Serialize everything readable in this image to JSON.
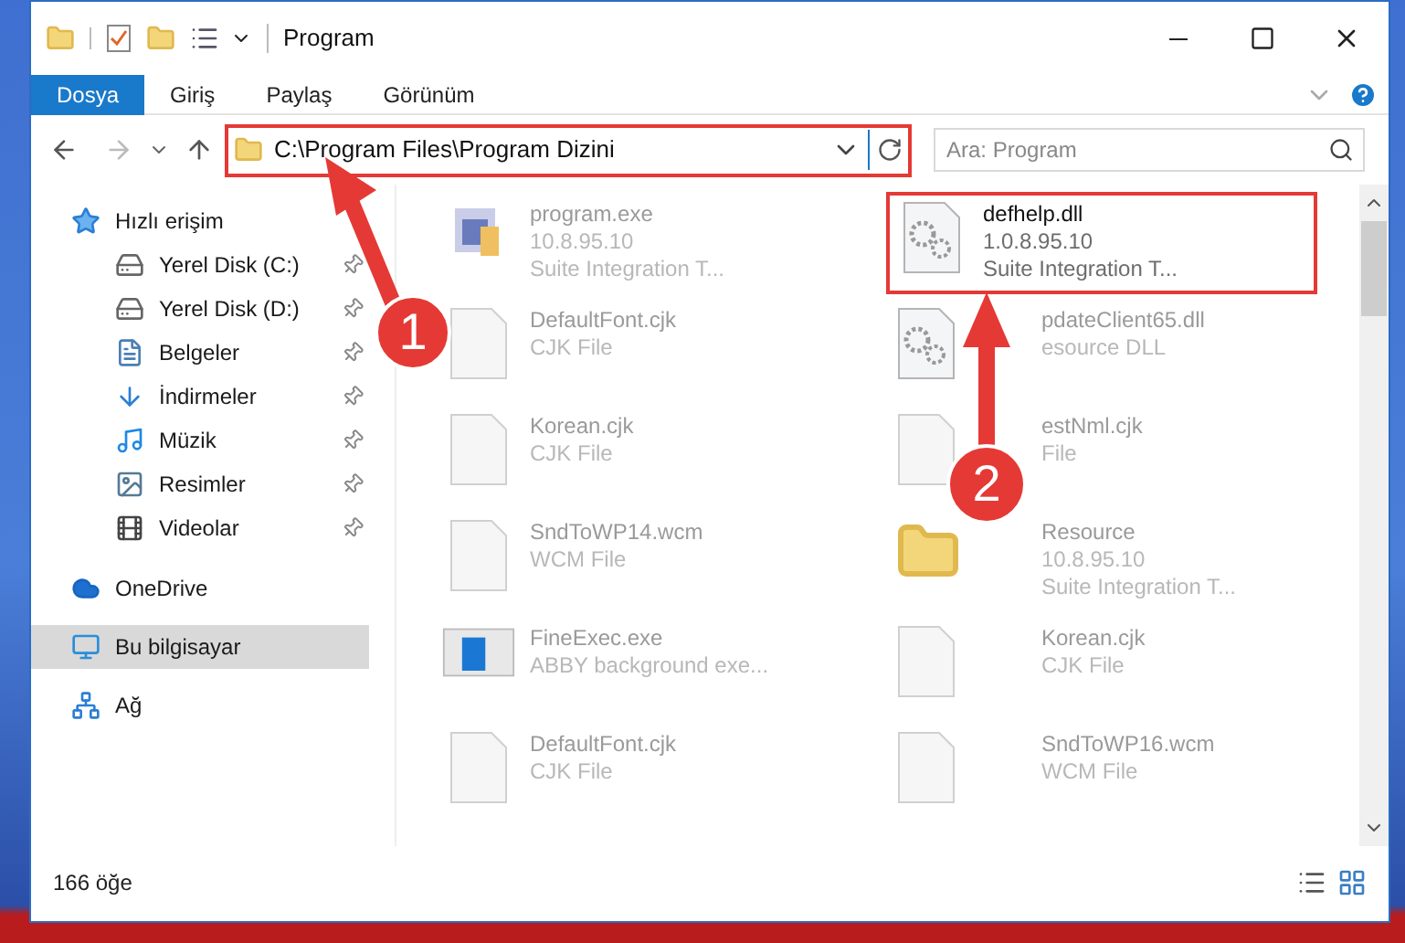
{
  "window": {
    "title": "Program"
  },
  "ribbon_tabs": [
    {
      "label": "Dosya",
      "selected": true
    },
    {
      "label": "Giriş",
      "selected": false
    },
    {
      "label": "Paylaş",
      "selected": false
    },
    {
      "label": "Görünüm",
      "selected": false
    }
  ],
  "address": {
    "path": "C:\\Program Files\\Program Dizini",
    "highlighted": true
  },
  "search": {
    "placeholder": "Ara: Program"
  },
  "sidebar": {
    "items": [
      {
        "label": "Hızlı erişim",
        "selected": false,
        "children": [
          {
            "label": "Yerel Disk (C:)",
            "pinned": true
          },
          {
            "label": "Yerel Disk (D:)",
            "pinned": true
          },
          {
            "label": "Belgeler",
            "pinned": true
          },
          {
            "label": "İndirmeler",
            "pinned": true
          },
          {
            "label": "Müzik",
            "pinned": true
          },
          {
            "label": "Resimler",
            "pinned": true
          },
          {
            "label": "Videolar",
            "pinned": true
          }
        ]
      },
      {
        "label": "OneDrive",
        "selected": false
      },
      {
        "label": "Bu bilgisayar",
        "selected": true
      },
      {
        "label": "Ağ",
        "selected": false
      }
    ]
  },
  "files": [
    {
      "name": "program.exe",
      "details": [
        "10.8.95.10",
        "Suite Integration T..."
      ],
      "kind": "exe",
      "highlighted": false
    },
    {
      "name": "defhelp.dll",
      "details": [
        "1.0.8.95.10",
        "Suite Integration T..."
      ],
      "kind": "dll",
      "highlighted": true
    },
    {
      "name": "DefaultFont.cjk",
      "details": [
        "CJK File"
      ],
      "kind": "blank",
      "highlighted": false
    },
    {
      "name": "pdateClient65.dll",
      "details": [
        "esource DLL"
      ],
      "kind": "dll",
      "highlighted": false
    },
    {
      "name": "Korean.cjk",
      "details": [
        "CJK File"
      ],
      "kind": "blank",
      "highlighted": false
    },
    {
      "name": "estNml.cjk",
      "details": [
        "File"
      ],
      "kind": "blank",
      "highlighted": false
    },
    {
      "name": "SndToWP14.wcm",
      "details": [
        "WCM File"
      ],
      "kind": "blank",
      "highlighted": false
    },
    {
      "name": "Resource",
      "details": [
        "10.8.95.10",
        "Suite Integration T..."
      ],
      "kind": "folder",
      "highlighted": false
    },
    {
      "name": "FineExec.exe",
      "details": [
        "ABBY background exe..."
      ],
      "kind": "app",
      "highlighted": false
    },
    {
      "name": "Korean.cjk",
      "details": [
        "CJK File"
      ],
      "kind": "blank",
      "highlighted": false
    },
    {
      "name": "DefaultFont.cjk",
      "details": [
        "CJK File"
      ],
      "kind": "blank",
      "highlighted": false
    },
    {
      "name": "SndToWP16.wcm",
      "details": [
        "WCM File"
      ],
      "kind": "blank",
      "highlighted": false
    }
  ],
  "status_bar": {
    "count": "166 öğe"
  },
  "annotations": [
    {
      "number": "1"
    },
    {
      "number": "2"
    }
  ]
}
